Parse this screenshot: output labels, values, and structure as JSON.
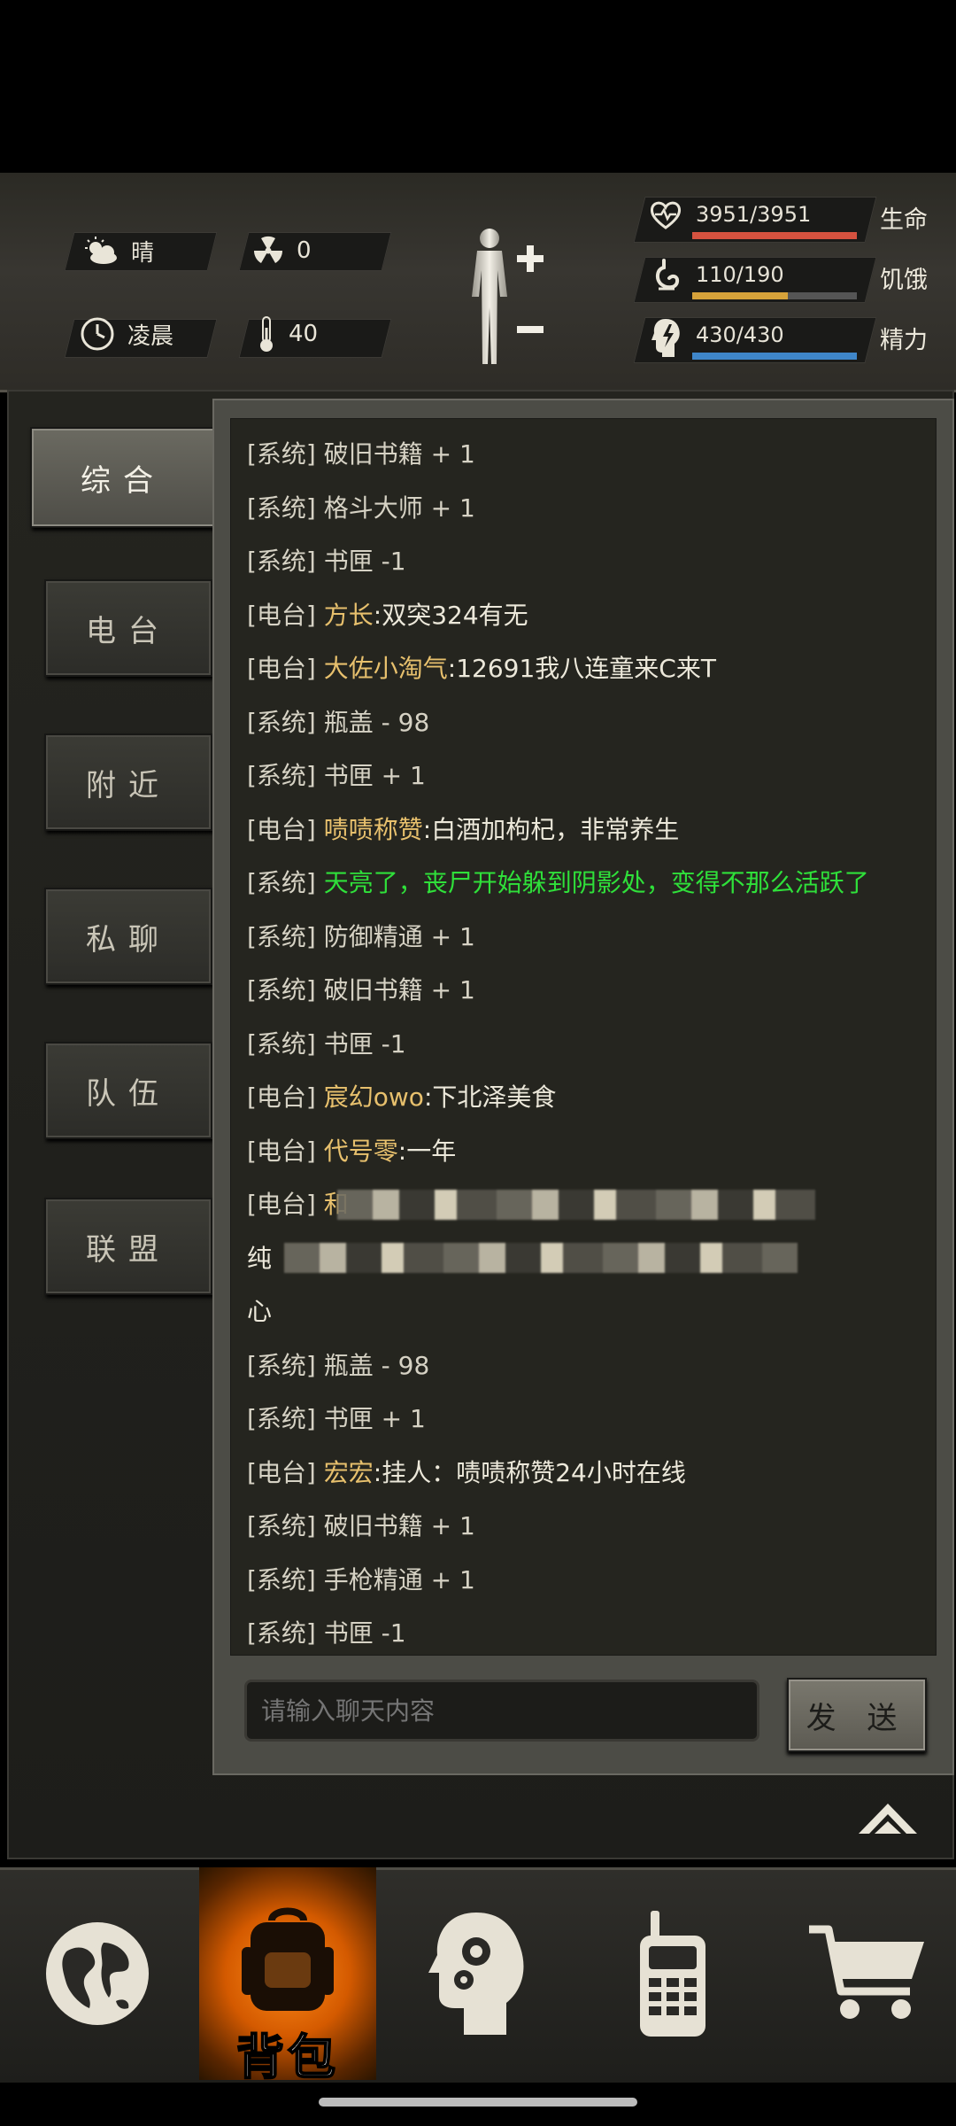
{
  "top": {
    "weather": "晴",
    "radiation": "0",
    "time": "凌晨",
    "temperature": "40"
  },
  "stats": [
    {
      "name": "生命",
      "value": "3951/3951",
      "fraction": 1.0,
      "color": "#d5523f"
    },
    {
      "name": "饥饿",
      "value": "110/190",
      "fraction": 0.58,
      "color": "#d6a23a"
    },
    {
      "name": "精力",
      "value": "430/430",
      "fraction": 1.0,
      "color": "#3f86c9"
    }
  ],
  "tabs": [
    "综合",
    "电台",
    "附近",
    "私聊",
    "队伍",
    "联盟"
  ],
  "chat": [
    {
      "tag": "[系统]",
      "kind": "sys",
      "name": "",
      "text": "破旧书籍 + 1"
    },
    {
      "tag": "[系统]",
      "kind": "sys",
      "name": "",
      "text": "格斗大师 + 1"
    },
    {
      "tag": "[系统]",
      "kind": "sys",
      "name": "",
      "text": "书匣 -1"
    },
    {
      "tag": "[电台]",
      "kind": "radio",
      "name": "方长",
      "text": ":双突324有无"
    },
    {
      "tag": "[电台]",
      "kind": "radio",
      "name": "大佐小淘气",
      "text": ":12691我八连童来C来T"
    },
    {
      "tag": "[系统]",
      "kind": "sys",
      "name": "",
      "text": "瓶盖 - 98"
    },
    {
      "tag": "[系统]",
      "kind": "sys",
      "name": "",
      "text": "书匣 + 1"
    },
    {
      "tag": "[电台]",
      "kind": "radio",
      "name": "啧啧称赞",
      "text": ":白酒加枸杞，非常养生"
    },
    {
      "tag": "[系统]",
      "kind": "green",
      "name": "",
      "text": "天亮了，丧尸开始躲到阴影处，变得不那么活跃了"
    },
    {
      "tag": "[系统]",
      "kind": "sys",
      "name": "",
      "text": "防御精通 + 1"
    },
    {
      "tag": "[系统]",
      "kind": "sys",
      "name": "",
      "text": "破旧书籍 + 1"
    },
    {
      "tag": "[系统]",
      "kind": "sys",
      "name": "",
      "text": "书匣 -1"
    },
    {
      "tag": "[电台]",
      "kind": "radio",
      "name": "宸幻owo",
      "text": ":下北泽美食"
    },
    {
      "tag": "[电台]",
      "kind": "radio",
      "name": "代号零",
      "text": ":一年"
    },
    {
      "tag": "[电台]",
      "kind": "radio",
      "name": "和",
      "text": ""
    },
    {
      "tag": "",
      "kind": "radio",
      "name": "",
      "text": "纯"
    },
    {
      "tag": "",
      "kind": "radio",
      "name": "",
      "text": "心"
    },
    {
      "tag": "[系统]",
      "kind": "sys",
      "name": "",
      "text": "瓶盖 - 98"
    },
    {
      "tag": "[系统]",
      "kind": "sys",
      "name": "",
      "text": "书匣 + 1"
    },
    {
      "tag": "[电台]",
      "kind": "radio",
      "name": "宏宏",
      "text": ":挂人：啧啧称赞24小时在线"
    },
    {
      "tag": "[系统]",
      "kind": "sys",
      "name": "",
      "text": "破旧书籍 + 1"
    },
    {
      "tag": "[系统]",
      "kind": "sys",
      "name": "",
      "text": "手枪精通 + 1"
    },
    {
      "tag": "[系统]",
      "kind": "sys",
      "name": "",
      "text": "书匣 -1"
    }
  ],
  "input": {
    "placeholder": "请输入聊天内容"
  },
  "send_label": "发 送",
  "nav": {
    "bag_label": "背包"
  }
}
